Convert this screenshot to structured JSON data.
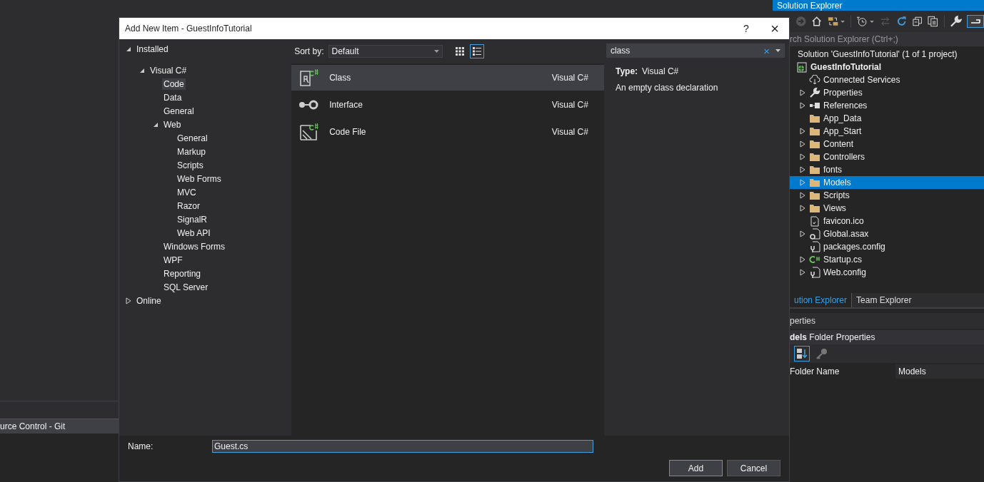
{
  "ide": {
    "bottom_panel": {
      "tab": "urce Control - Git"
    },
    "solution_explorer": {
      "title": "Solution Explorer",
      "search": {
        "placeholder": "rch Solution Explorer (Ctrl+;)"
      },
      "tree": [
        {
          "label": "Solution 'GuestInfoTutorial' (1 of 1 project)",
          "selected": false,
          "children": [
            {
              "label": "GuestInfoTutorial",
              "kind": "project",
              "selected": false,
              "children": [
                {
                  "label": "Connected Services",
                  "kind": "connected",
                  "selected": false
                },
                {
                  "label": "Properties",
                  "kind": "properties",
                  "expanded": false,
                  "selected": false
                },
                {
                  "label": "References",
                  "kind": "references",
                  "expanded": false,
                  "selected": false
                },
                {
                  "label": "App_Data",
                  "kind": "folder",
                  "selected": false
                },
                {
                  "label": "App_Start",
                  "kind": "folder",
                  "expanded": false,
                  "selected": false
                },
                {
                  "label": "Content",
                  "kind": "folder",
                  "expanded": false,
                  "selected": false
                },
                {
                  "label": "Controllers",
                  "kind": "folder",
                  "expanded": false,
                  "selected": false
                },
                {
                  "label": "fonts",
                  "kind": "folder",
                  "expanded": false,
                  "selected": false
                },
                {
                  "label": "Models",
                  "kind": "folder",
                  "expanded": false,
                  "selected": true
                },
                {
                  "label": "Scripts",
                  "kind": "folder",
                  "expanded": false,
                  "selected": false
                },
                {
                  "label": "Views",
                  "kind": "folder",
                  "expanded": false,
                  "selected": false
                },
                {
                  "label": "favicon.ico",
                  "kind": "image",
                  "selected": false
                },
                {
                  "label": "Global.asax",
                  "kind": "settings",
                  "expanded": false,
                  "selected": false
                },
                {
                  "label": "packages.config",
                  "kind": "config",
                  "selected": false
                },
                {
                  "label": "Startup.cs",
                  "kind": "csharp",
                  "expanded": false,
                  "selected": false
                },
                {
                  "label": "Web.config",
                  "kind": "config",
                  "expanded": false,
                  "selected": false
                }
              ]
            }
          ]
        }
      ],
      "tabs": [
        {
          "label": "ution Explorer",
          "selected": true
        },
        {
          "label": "Team Explorer",
          "selected": false
        }
      ]
    },
    "properties": {
      "title": "perties",
      "object": "**dels** Folder Properties",
      "sort_alphabetical": true,
      "rows": [
        {
          "name": "Folder Name",
          "value": "Models"
        }
      ]
    }
  },
  "dialog": {
    "title": "Add New Item - GuestInfoTutorial",
    "help": "?",
    "close": "×",
    "tree": [
      {
        "label": "Installed",
        "expanded": true,
        "selected": false,
        "children": [
          {
            "label": "Visual C#",
            "expanded": true,
            "selected": false,
            "children": [
              {
                "label": "Code",
                "selected": true
              },
              {
                "label": "Data",
                "selected": false
              },
              {
                "label": "General",
                "selected": false
              },
              {
                "label": "Web",
                "expanded": true,
                "selected": false,
                "children": [
                  {
                    "label": "General",
                    "selected": false
                  },
                  {
                    "label": "Markup",
                    "selected": false
                  },
                  {
                    "label": "Scripts",
                    "selected": false
                  },
                  {
                    "label": "Web Forms",
                    "selected": false
                  },
                  {
                    "label": "MVC",
                    "selected": false
                  },
                  {
                    "label": "Razor",
                    "selected": false
                  },
                  {
                    "label": "SignalR",
                    "selected": false
                  },
                  {
                    "label": "Web API",
                    "selected": false
                  }
                ]
              },
              {
                "label": "Windows Forms",
                "selected": false
              },
              {
                "label": "WPF",
                "selected": false
              },
              {
                "label": "Reporting",
                "selected": false
              },
              {
                "label": "SQL Server",
                "selected": false
              }
            ]
          }
        ]
      },
      {
        "label": "Online",
        "expanded": false,
        "selected": false
      }
    ],
    "sort_label": "Sort by:",
    "sort_value": "Default",
    "views": [
      {
        "kind": "grid",
        "selected": false
      },
      {
        "kind": "list",
        "selected": true
      }
    ],
    "templates": [
      {
        "name": "Class",
        "language": "Visual C#",
        "kind": "class",
        "selected": true
      },
      {
        "name": "Interface",
        "language": "Visual C#",
        "kind": "interface",
        "selected": false
      },
      {
        "name": "Code File",
        "language": "Visual C#",
        "kind": "codefile",
        "selected": false
      }
    ],
    "search": {
      "value": "class",
      "clear": "×"
    },
    "details": {
      "type_label": "Type:",
      "type_value": "Visual C#",
      "description": "An empty class declaration"
    },
    "name_label": "Name:",
    "name_value": "Guest.cs",
    "buttons": [
      {
        "label": "Add",
        "default": true
      },
      {
        "label": "Cancel",
        "default": false
      }
    ]
  }
}
